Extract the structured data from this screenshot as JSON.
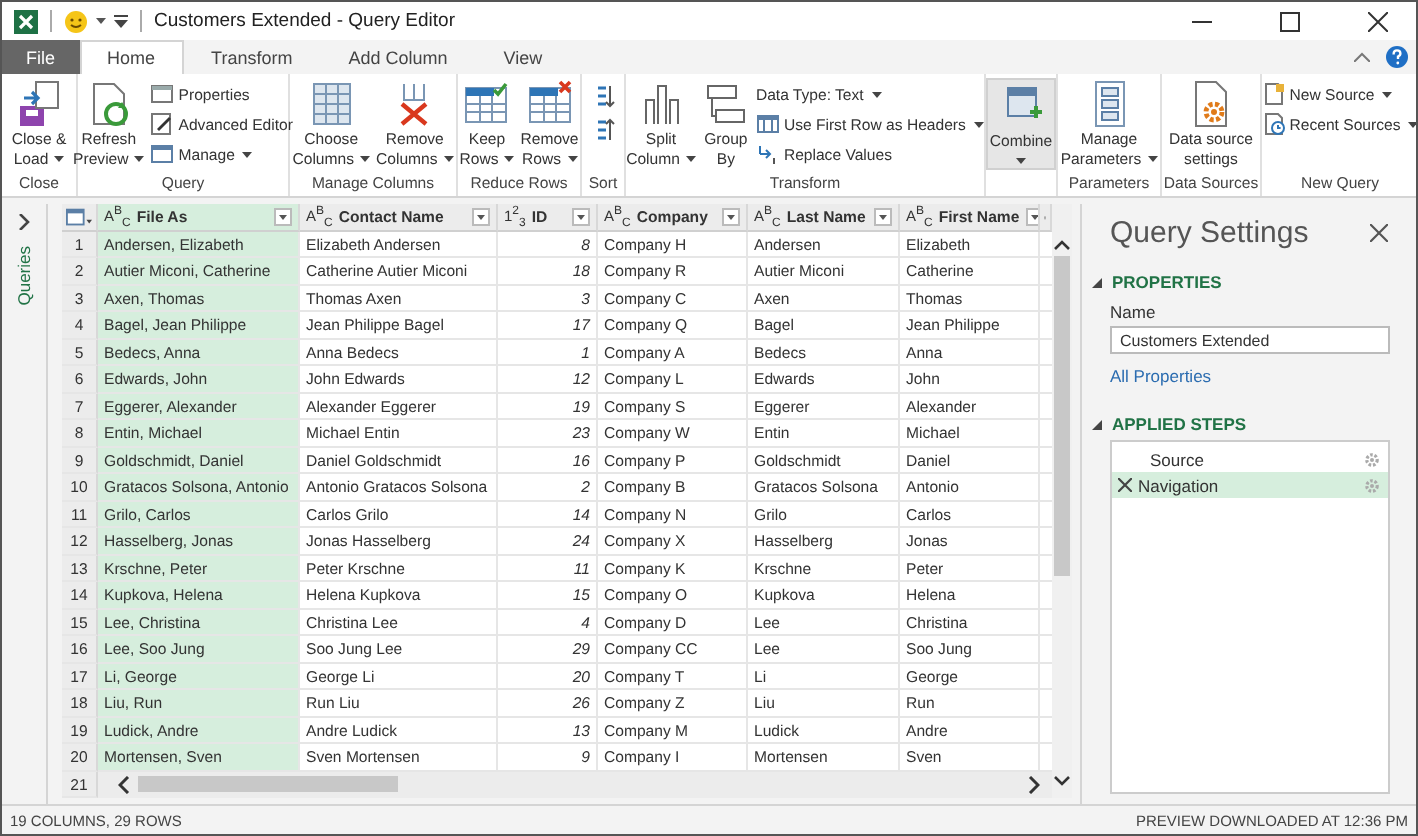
{
  "window": {
    "title": "Customers Extended - Query Editor"
  },
  "tabs": [
    {
      "label": "File",
      "kind": "file",
      "selected": false
    },
    {
      "label": "Home",
      "kind": "tab",
      "selected": true
    },
    {
      "label": "Transform",
      "kind": "tab",
      "selected": false
    },
    {
      "label": "Add Column",
      "kind": "tab",
      "selected": false
    },
    {
      "label": "View",
      "kind": "tab",
      "selected": false
    }
  ],
  "ribbon": [
    {
      "label": "Close",
      "buttons": [
        {
          "kind": "large",
          "lines": [
            "Close &",
            "Load"
          ],
          "dropdown": true
        }
      ]
    },
    {
      "label": "Query",
      "buttons": [
        {
          "kind": "large",
          "lines": [
            "Refresh",
            "Preview"
          ],
          "dropdown": true
        },
        {
          "kind": "small",
          "label": "Properties",
          "dropdown": false
        },
        {
          "kind": "small",
          "label": "Advanced Editor",
          "dropdown": false
        },
        {
          "kind": "small",
          "label": "Manage",
          "dropdown": true
        }
      ]
    },
    {
      "label": "Manage Columns",
      "buttons": [
        {
          "kind": "large",
          "lines": [
            "Choose",
            "Columns"
          ],
          "dropdown": true
        },
        {
          "kind": "large",
          "lines": [
            "Remove",
            "Columns"
          ],
          "dropdown": true
        }
      ]
    },
    {
      "label": "Reduce Rows",
      "buttons": [
        {
          "kind": "large",
          "lines": [
            "Keep",
            "Rows"
          ],
          "dropdown": true
        },
        {
          "kind": "large",
          "lines": [
            "Remove",
            "Rows"
          ],
          "dropdown": true
        }
      ]
    },
    {
      "label": "Sort",
      "buttons": [
        {
          "kind": "icon"
        },
        {
          "kind": "icon"
        }
      ]
    },
    {
      "label": "Transform",
      "buttons": [
        {
          "kind": "large",
          "lines": [
            "Split",
            "Column"
          ],
          "dropdown": true
        },
        {
          "kind": "large",
          "lines": [
            "Group",
            "By"
          ],
          "dropdown": false
        },
        {
          "kind": "small",
          "label": "Data Type: Text",
          "dropdown": true
        },
        {
          "kind": "small",
          "label": "Use First Row as Headers",
          "dropdown": true
        },
        {
          "kind": "small",
          "label": "Replace Values",
          "dropdown": false
        }
      ]
    },
    {
      "buttons": [
        {
          "kind": "large",
          "lines": [
            "Combine"
          ],
          "dropdown": true,
          "highlighted": true
        }
      ]
    },
    {
      "label": "Parameters",
      "buttons": [
        {
          "kind": "large",
          "lines": [
            "Manage",
            "Parameters"
          ],
          "dropdown": true
        }
      ]
    },
    {
      "label": "Data Sources",
      "buttons": [
        {
          "kind": "large",
          "lines": [
            "Data source",
            "settings"
          ],
          "dropdown": false
        }
      ]
    },
    {
      "label": "New Query",
      "buttons": [
        {
          "kind": "small",
          "label": "New Source",
          "dropdown": true
        },
        {
          "kind": "small",
          "label": "Recent Sources",
          "dropdown": true
        }
      ]
    }
  ],
  "queries_pane": {
    "label": "Queries"
  },
  "table": {
    "columns": [
      {
        "name": "File As",
        "kind": "text",
        "type_icon": "A$^{B}$$_{C}$",
        "selected": true
      },
      {
        "name": "Contact Name",
        "kind": "text",
        "type_icon": "A$^{B}$$_{C}$",
        "selected": false
      },
      {
        "name": "ID",
        "kind": "number",
        "type_icon": "1$^{2}$$_{3}$",
        "selected": false
      },
      {
        "name": "Company",
        "kind": "text",
        "type_icon": "A$^{B}$$_{C}$",
        "selected": false
      },
      {
        "name": "Last Name",
        "kind": "text",
        "type_icon": "A$^{B}$$_{C}$",
        "selected": false
      },
      {
        "name": "First Name",
        "kind": "text",
        "type_icon": "A$^{B}$$_{C}$",
        "selected": false
      }
    ],
    "rows": [
      {
        "number": "1",
        "cells": [
          "Andersen, Elizabeth",
          "Elizabeth Andersen",
          "8",
          "Company H",
          "Andersen",
          "Elizabeth"
        ]
      },
      {
        "number": "2",
        "cells": [
          "Autier Miconi, Catherine",
          "Catherine Autier Miconi",
          "18",
          "Company R",
          "Autier Miconi",
          "Catherine"
        ]
      },
      {
        "number": "3",
        "cells": [
          "Axen, Thomas",
          "Thomas Axen",
          "3",
          "Company C",
          "Axen",
          "Thomas"
        ]
      },
      {
        "number": "4",
        "cells": [
          "Bagel, Jean Philippe",
          "Jean Philippe Bagel",
          "17",
          "Company Q",
          "Bagel",
          "Jean Philippe"
        ]
      },
      {
        "number": "5",
        "cells": [
          "Bedecs, Anna",
          "Anna Bedecs",
          "1",
          "Company A",
          "Bedecs",
          "Anna"
        ]
      },
      {
        "number": "6",
        "cells": [
          "Edwards, John",
          "John Edwards",
          "12",
          "Company L",
          "Edwards",
          "John"
        ]
      },
      {
        "number": "7",
        "cells": [
          "Eggerer, Alexander",
          "Alexander Eggerer",
          "19",
          "Company S",
          "Eggerer",
          "Alexander"
        ]
      },
      {
        "number": "8",
        "cells": [
          "Entin, Michael",
          "Michael Entin",
          "23",
          "Company W",
          "Entin",
          "Michael"
        ]
      },
      {
        "number": "9",
        "cells": [
          "Goldschmidt, Daniel",
          "Daniel Goldschmidt",
          "16",
          "Company P",
          "Goldschmidt",
          "Daniel"
        ]
      },
      {
        "number": "10",
        "cells": [
          "Gratacos Solsona, Antonio",
          "Antonio Gratacos Solsona",
          "2",
          "Company B",
          "Gratacos Solsona",
          "Antonio"
        ]
      },
      {
        "number": "11",
        "cells": [
          "Grilo, Carlos",
          "Carlos Grilo",
          "14",
          "Company N",
          "Grilo",
          "Carlos"
        ]
      },
      {
        "number": "12",
        "cells": [
          "Hasselberg, Jonas",
          "Jonas Hasselberg",
          "24",
          "Company X",
          "Hasselberg",
          "Jonas"
        ]
      },
      {
        "number": "13",
        "cells": [
          "Krschne, Peter",
          "Peter Krschne",
          "11",
          "Company K",
          "Krschne",
          "Peter"
        ]
      },
      {
        "number": "14",
        "cells": [
          "Kupkova, Helena",
          "Helena Kupkova",
          "15",
          "Company O",
          "Kupkova",
          "Helena"
        ]
      },
      {
        "number": "15",
        "cells": [
          "Lee, Christina",
          "Christina Lee",
          "4",
          "Company D",
          "Lee",
          "Christina"
        ]
      },
      {
        "number": "16",
        "cells": [
          "Lee, Soo Jung",
          "Soo Jung Lee",
          "29",
          "Company CC",
          "Lee",
          "Soo Jung"
        ]
      },
      {
        "number": "17",
        "cells": [
          "Li, George",
          "George Li",
          "20",
          "Company T",
          "Li",
          "George"
        ]
      },
      {
        "number": "18",
        "cells": [
          "Liu, Run",
          "Run Liu",
          "26",
          "Company Z",
          "Liu",
          "Run"
        ]
      },
      {
        "number": "19",
        "cells": [
          "Ludick, Andre",
          "Andre Ludick",
          "13",
          "Company M",
          "Ludick",
          "Andre"
        ]
      },
      {
        "number": "20",
        "cells": [
          "Mortensen, Sven",
          "Sven Mortensen",
          "9",
          "Company I",
          "Mortensen",
          "Sven"
        ]
      },
      {
        "number": "21"
      }
    ]
  },
  "query_settings": {
    "title": "Query Settings",
    "properties": {
      "heading": "PROPERTIES",
      "expanded": true,
      "name_label": "Name",
      "name_value": "Customers Extended",
      "link": "All Properties"
    },
    "applied_steps": {
      "heading": "APPLIED STEPS",
      "expanded": true,
      "steps": [
        {
          "label": "Source",
          "selected": false
        },
        {
          "label": "Navigation",
          "selected": true
        }
      ]
    }
  },
  "status_bar": {
    "left": "19 COLUMNS, 29 ROWS",
    "right": "PREVIEW DOWNLOADED AT 12:36 PM"
  }
}
